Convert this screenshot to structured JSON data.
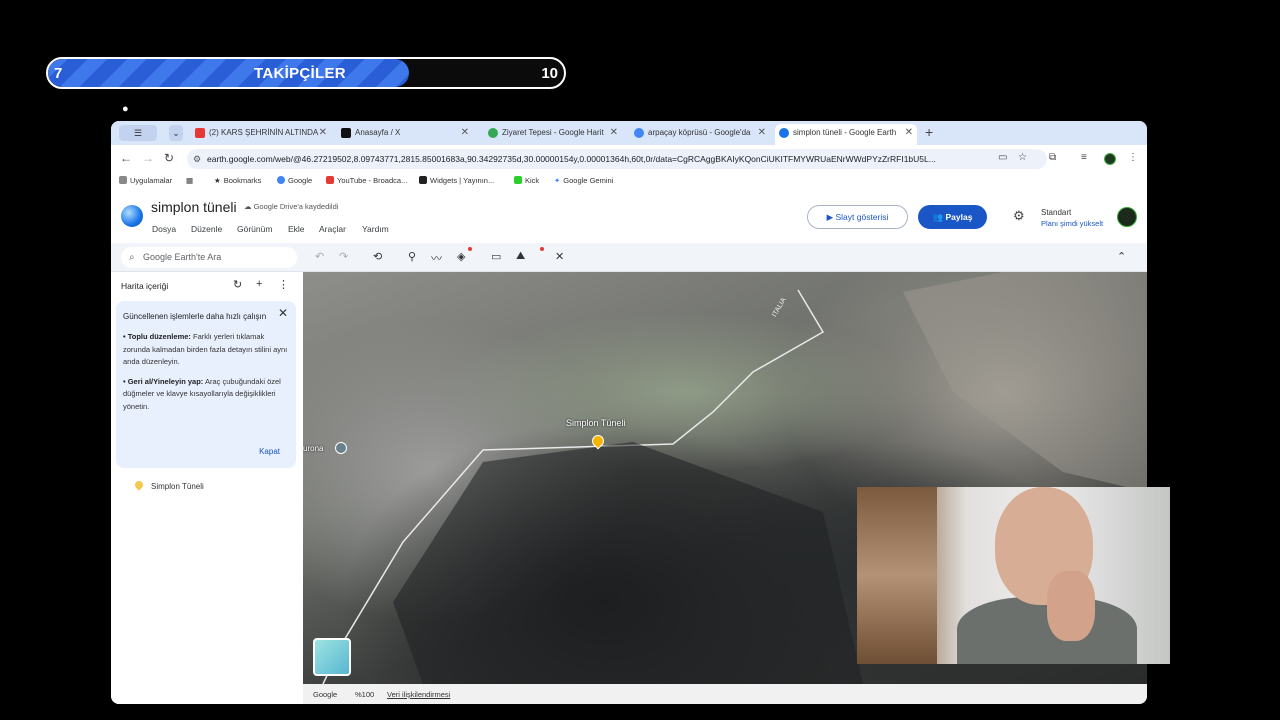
{
  "overlay": {
    "followers_label": "TAKİPÇİLER",
    "current": "7",
    "goal": "10",
    "progress_fraction": 0.7
  },
  "tabs": [
    {
      "title": "(2) KARS ŞEHRİNİN ALTINDA",
      "favicon": "youtube-icon",
      "active": false
    },
    {
      "title": "Anasayfa / X",
      "favicon": "x-icon",
      "active": false
    },
    {
      "title": "Ziyaret Tepesi - Google Harit",
      "favicon": "maps-icon",
      "active": false
    },
    {
      "title": "arpaçay köprüsü - Google'da",
      "favicon": "google-icon",
      "active": false
    },
    {
      "title": "simplon tüneli - Google Earth",
      "favicon": "earth-icon",
      "active": true
    }
  ],
  "address_bar": {
    "url": "earth.google.com/web/@46.27219502,8.09743771,2815.85001683a,90.34292735d,30.00000154y,0.00001364h,60t,0r/data=CgRCAggBKAIyKQonCiUKITFMYWRUaENrWWdPYzZrRFI1bU5L..."
  },
  "bookmarks": [
    {
      "label": "Uygulamalar"
    },
    {
      "label": "Bookmarks"
    },
    {
      "label": "Google"
    },
    {
      "label": "YouTube - Broadca..."
    },
    {
      "label": "Widgets | Yayının..."
    },
    {
      "label": "Kick"
    },
    {
      "label": "Google Gemini"
    }
  ],
  "earth": {
    "doc_title": "simplon tüneli",
    "saved_status": "Google Drive'a kaydedildi",
    "menu": [
      "Dosya",
      "Düzenle",
      "Görünüm",
      "Ekle",
      "Araçlar",
      "Yardım"
    ],
    "slideshow_label": "Slayt gösterisi",
    "share_label": "Paylaş",
    "plan_name": "Standart",
    "plan_upgrade": "Planı şimdi yükselt",
    "search_placeholder": "Google Earth'te Ara"
  },
  "panel": {
    "title": "Harita içeriği",
    "tip_title": "Güncellenen işlemlerle daha hızlı çalışın",
    "tip1_bold": "• Toplu düzenleme:",
    "tip1_text": " Farklı yerleri tıklamak zorunda kalmadan birden fazla detayın stilini aynı anda düzenleyin.",
    "tip2_bold": "• Geri al/Yineleyin yap:",
    "tip2_text": " Araç çubuğundaki özel düğmeler ve klavye kısayollarıyla değişiklikleri yönetin.",
    "tip_close": "Kapat",
    "place_name": "Simplon Tüneli"
  },
  "map": {
    "pin_label": "Simplon Tüneli",
    "side_label": "urona",
    "road_label": "ITALIA"
  },
  "footer": {
    "brand": "Google",
    "zoom": "%100",
    "data_link": "Veri ilişkilendirmesi"
  },
  "colors": {
    "accent": "#1a56c6",
    "progress": "#3f78ea",
    "tabbar": "#d9e6fa",
    "pin": "#f4b400"
  }
}
